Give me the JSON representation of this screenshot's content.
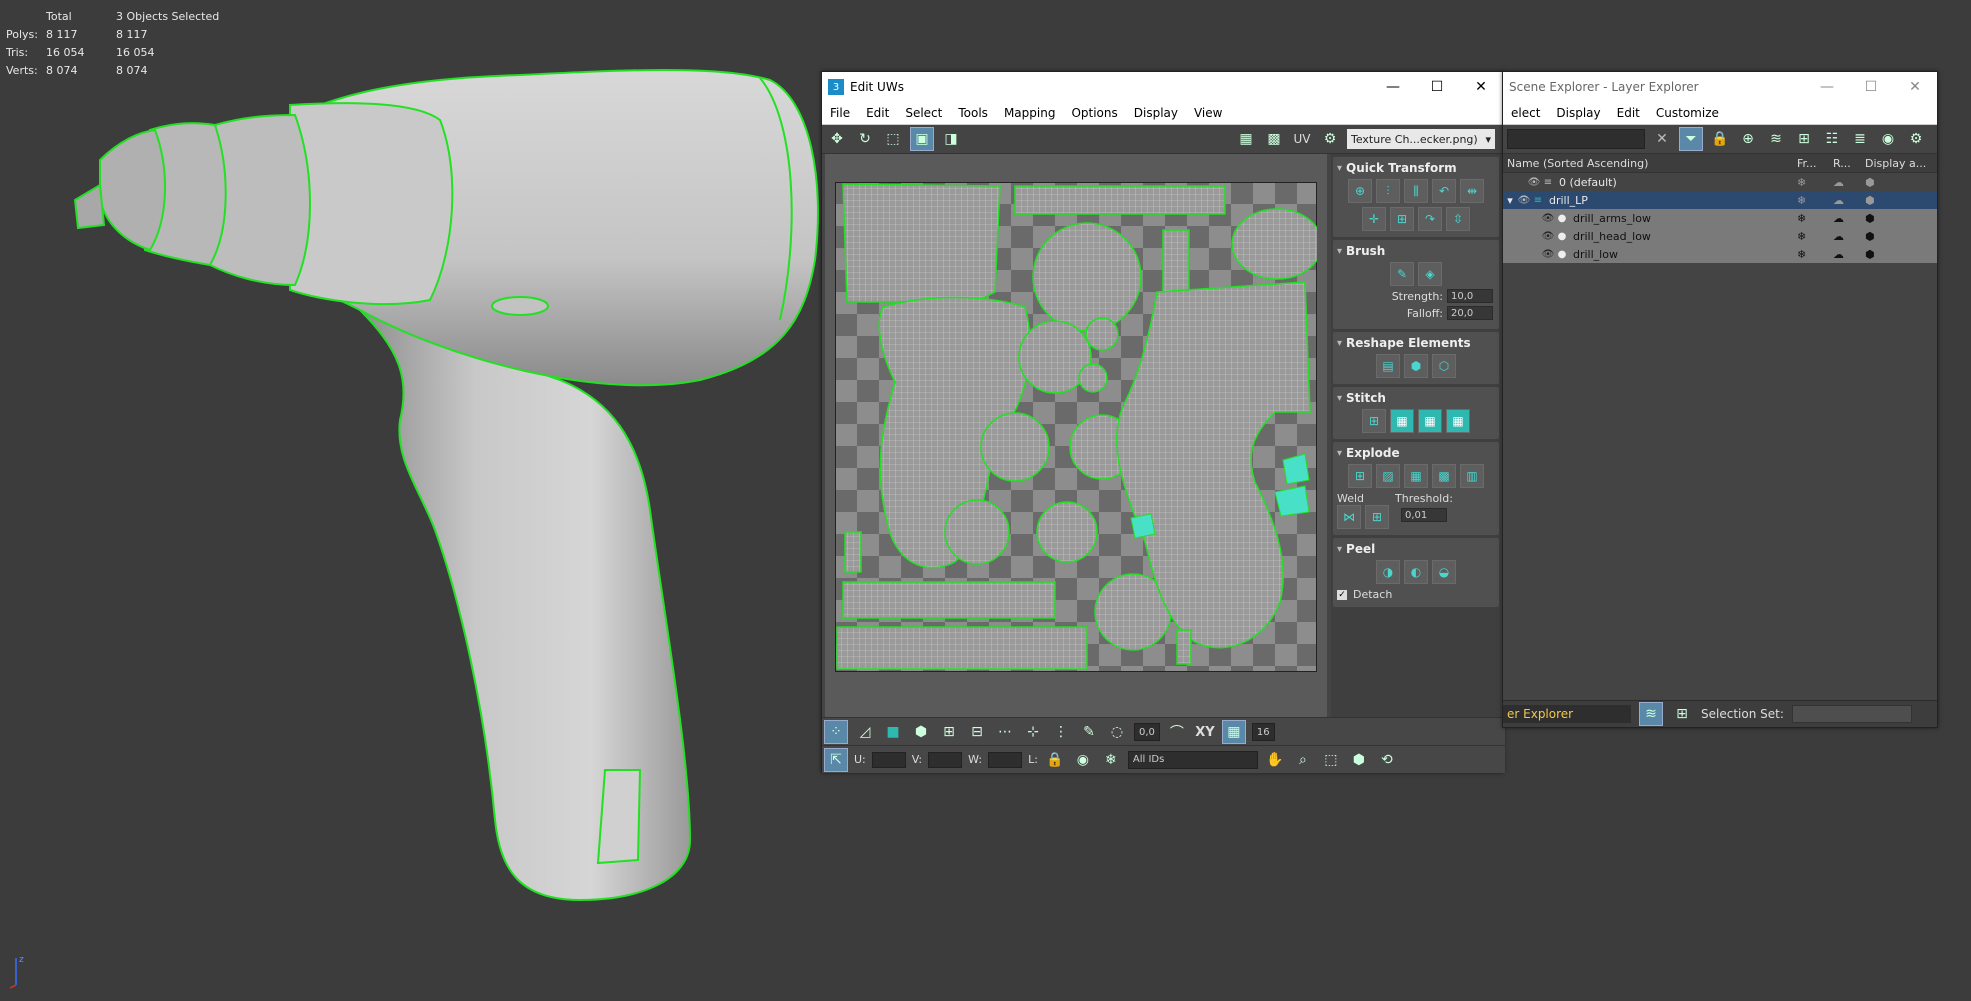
{
  "viewport": {
    "stats": {
      "header": [
        "",
        "Total",
        "3 Objects Selected"
      ],
      "rows": [
        {
          "label": "Polys:",
          "total": "8 117",
          "selected": "8 117"
        },
        {
          "label": "Tris:",
          "total": "16 054",
          "selected": "16 054"
        },
        {
          "label": "Verts:",
          "total": "8 074",
          "selected": "8 074"
        }
      ]
    },
    "axis_label": "z"
  },
  "uv_editor": {
    "title": "Edit UWs",
    "menu": [
      "File",
      "Edit",
      "Select",
      "Tools",
      "Mapping",
      "Options",
      "Display",
      "View"
    ],
    "toolbar": {
      "uv_label": "UV",
      "texture_dropdown": "Texture Ch...ecker.png)"
    },
    "panels": {
      "quick_transform": "Quick Transform",
      "brush": {
        "title": "Brush",
        "strength_label": "Strength:",
        "strength_value": "10,0",
        "falloff_label": "Falloff:",
        "falloff_value": "20,0"
      },
      "reshape": "Reshape Elements",
      "stitch": "Stitch",
      "explode": {
        "title": "Explode",
        "weld_label": "Weld",
        "threshold_label": "Threshold:",
        "threshold_value": "0,01"
      },
      "peel": {
        "title": "Peel",
        "detach_label": "Detach"
      }
    },
    "bottom": {
      "angle_value": "0,0",
      "xy_label": "XY",
      "grid_value": "16",
      "u_label": "U:",
      "v_label": "V:",
      "w_label": "W:",
      "l_label": "L:",
      "ids_dropdown": "All IDs"
    }
  },
  "scene_explorer": {
    "title": "Scene Explorer - Layer Explorer",
    "menu": [
      "elect",
      "Display",
      "Edit",
      "Customize"
    ],
    "columns": [
      "Name (Sorted Ascending)",
      "Fr...",
      "R...",
      "Display a..."
    ],
    "rows": [
      {
        "name": "0 (default)"
      },
      {
        "name": "drill_LP"
      },
      {
        "name": "drill_arms_low"
      },
      {
        "name": "drill_head_low"
      },
      {
        "name": "drill_low"
      }
    ],
    "footer": {
      "explorer_type": "er Explorer",
      "selection_set_label": "Selection Set:"
    }
  },
  "colors": {
    "selection_outline": "#22e022",
    "viewport_bg": "#3c3c3c",
    "stats_text": "#e6c84a",
    "accent_teal": "#2fb8b0"
  }
}
